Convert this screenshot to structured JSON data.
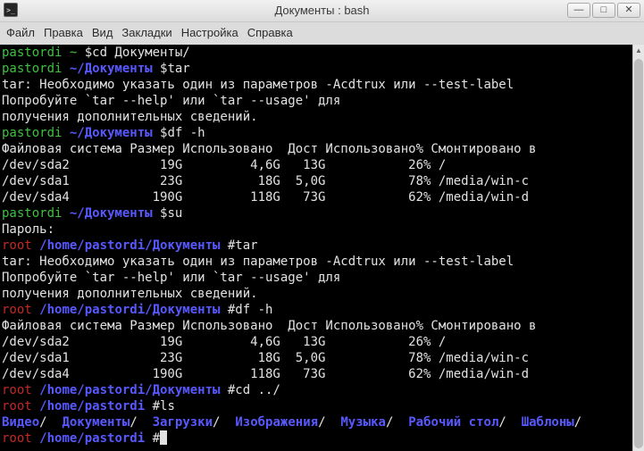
{
  "window": {
    "title": "Документы : bash",
    "icon": "terminal-icon",
    "controls": {
      "minimize_icon": "minimize-icon",
      "minimize_glyph": "—",
      "maximize_icon": "maximize-icon",
      "maximize_glyph": "□",
      "close_icon": "close-icon",
      "close_glyph": "✕"
    }
  },
  "menu": {
    "items": [
      "Файл",
      "Правка",
      "Вид",
      "Закладки",
      "Настройка",
      "Справка"
    ]
  },
  "colors": {
    "background": "#000000",
    "text": "#e2e2e2",
    "user_prompt": "#40c040",
    "root_prompt": "#c02a2a",
    "path": "#5858ff",
    "directory": "#5858ff"
  },
  "terminal": {
    "lines": [
      [
        {
          "t": "pastordi ~ ",
          "c": "user"
        },
        {
          "t": "$cd Документы/",
          "c": "plain"
        }
      ],
      [
        {
          "t": "pastordi ",
          "c": "user"
        },
        {
          "t": "~/Документы ",
          "c": "path"
        },
        {
          "t": "$tar",
          "c": "plain"
        }
      ],
      [
        {
          "t": "tar: Необходимо указать один из параметров -Acdtrux или --test-label",
          "c": "plain"
        }
      ],
      [
        {
          "t": "Попробуйте `tar --help' или `tar --usage' для",
          "c": "plain"
        }
      ],
      [
        {
          "t": "получения дополнительных сведений.",
          "c": "plain"
        }
      ],
      [
        {
          "t": "pastordi ",
          "c": "user"
        },
        {
          "t": "~/Документы ",
          "c": "path"
        },
        {
          "t": "$df -h",
          "c": "plain"
        }
      ],
      [
        {
          "t": "Файловая система Размер Использовано  Дост Использовано% Смонтировано в",
          "c": "plain"
        }
      ],
      [
        {
          "t": "/dev/sda2            19G         4,6G   13G           26% /",
          "c": "plain"
        }
      ],
      [
        {
          "t": "/dev/sda1            23G          18G  5,0G           78% /media/win-c",
          "c": "plain"
        }
      ],
      [
        {
          "t": "/dev/sda4           190G         118G   73G           62% /media/win-d",
          "c": "plain"
        }
      ],
      [
        {
          "t": "pastordi ",
          "c": "user"
        },
        {
          "t": "~/Документы ",
          "c": "path"
        },
        {
          "t": "$su",
          "c": "plain"
        }
      ],
      [
        {
          "t": "Пароль:",
          "c": "plain"
        }
      ],
      [
        {
          "t": "root ",
          "c": "root"
        },
        {
          "t": "/home/pastordi/Документы ",
          "c": "path"
        },
        {
          "t": "#tar",
          "c": "plain"
        }
      ],
      [
        {
          "t": "tar: Необходимо указать один из параметров -Acdtrux или --test-label",
          "c": "plain"
        }
      ],
      [
        {
          "t": "Попробуйте `tar --help' или `tar --usage' для",
          "c": "plain"
        }
      ],
      [
        {
          "t": "получения дополнительных сведений.",
          "c": "plain"
        }
      ],
      [
        {
          "t": "root ",
          "c": "root"
        },
        {
          "t": "/home/pastordi/Документы ",
          "c": "path"
        },
        {
          "t": "#df -h",
          "c": "plain"
        }
      ],
      [
        {
          "t": "Файловая система Размер Использовано  Дост Использовано% Смонтировано в",
          "c": "plain"
        }
      ],
      [
        {
          "t": "/dev/sda2            19G         4,6G   13G           26% /",
          "c": "plain"
        }
      ],
      [
        {
          "t": "/dev/sda1            23G          18G  5,0G           78% /media/win-c",
          "c": "plain"
        }
      ],
      [
        {
          "t": "/dev/sda4           190G         118G   73G           62% /media/win-d",
          "c": "plain"
        }
      ],
      [
        {
          "t": "root ",
          "c": "root"
        },
        {
          "t": "/home/pastordi/Документы ",
          "c": "path"
        },
        {
          "t": "#cd ../",
          "c": "plain"
        }
      ],
      [
        {
          "t": "root ",
          "c": "root"
        },
        {
          "t": "/home/pastordi ",
          "c": "path"
        },
        {
          "t": "#ls",
          "c": "plain"
        }
      ],
      [
        {
          "t": "Видео",
          "c": "dir"
        },
        {
          "t": "/  ",
          "c": "plain"
        },
        {
          "t": "Документы",
          "c": "dir"
        },
        {
          "t": "/  ",
          "c": "plain"
        },
        {
          "t": "Загрузки",
          "c": "dir"
        },
        {
          "t": "/  ",
          "c": "plain"
        },
        {
          "t": "Изображения",
          "c": "dir"
        },
        {
          "t": "/  ",
          "c": "plain"
        },
        {
          "t": "Музыка",
          "c": "dir"
        },
        {
          "t": "/  ",
          "c": "plain"
        },
        {
          "t": "Рабочий стол",
          "c": "dir"
        },
        {
          "t": "/  ",
          "c": "plain"
        },
        {
          "t": "Шаблоны",
          "c": "dir"
        },
        {
          "t": "/",
          "c": "plain"
        }
      ],
      [
        {
          "t": "root ",
          "c": "root"
        },
        {
          "t": "/home/pastordi ",
          "c": "path"
        },
        {
          "t": "#",
          "c": "plain"
        },
        {
          "t": "",
          "c": "cursor"
        }
      ]
    ]
  }
}
